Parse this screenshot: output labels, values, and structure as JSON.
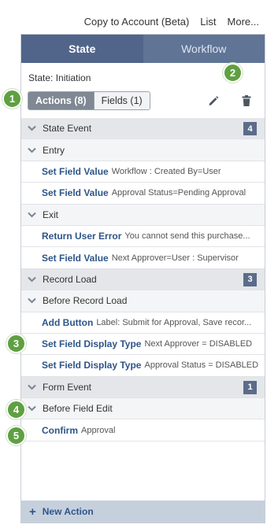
{
  "top_links": [
    "Copy to Account (Beta)",
    "List",
    "More..."
  ],
  "tabs": [
    {
      "label": "State",
      "active": true
    },
    {
      "label": "Workflow",
      "active": false
    }
  ],
  "state_title": "State: Initiation",
  "segments": {
    "actions": "Actions (8)",
    "fields": "Fields (1)"
  },
  "toolbar": {
    "edit_icon": "pencil-icon",
    "delete_icon": "trash-icon"
  },
  "rows": [
    {
      "type": "group",
      "label": "State Event",
      "badge": "4"
    },
    {
      "type": "sub",
      "label": "Entry"
    },
    {
      "type": "action",
      "name": "Set Field Value",
      "desc": "Workflow : Created By=User"
    },
    {
      "type": "action",
      "name": "Set Field Value",
      "desc": "Approval Status=Pending Approval"
    },
    {
      "type": "sub",
      "label": "Exit"
    },
    {
      "type": "action",
      "name": "Return User Error",
      "desc": "You cannot send this purchase..."
    },
    {
      "type": "action",
      "name": "Set Field Value",
      "desc": "Next Approver=User : Supervisor"
    },
    {
      "type": "group",
      "label": "Record Load",
      "badge": "3"
    },
    {
      "type": "sub",
      "label": "Before Record Load"
    },
    {
      "type": "action",
      "name": "Add Button",
      "desc": "Label: Submit for Approval, Save recor..."
    },
    {
      "type": "action",
      "name": "Set Field Display Type",
      "desc": "Next Approver = DISABLED"
    },
    {
      "type": "action",
      "name": "Set Field Display Type",
      "desc": "Approval Status = DISABLED"
    },
    {
      "type": "group",
      "label": "Form Event",
      "badge": "1"
    },
    {
      "type": "sub",
      "label": "Before Field Edit"
    },
    {
      "type": "action",
      "name": "Confirm",
      "desc": "Approval"
    }
  ],
  "footer": {
    "label": "New Action"
  },
  "callouts": [
    "1",
    "2",
    "3",
    "4",
    "5"
  ],
  "colors": {
    "tab_bar": "#607496",
    "link_blue": "#2e5588",
    "callout_green": "#5fa042",
    "badge": "#5b6c8a",
    "footer": "#c6d0dd"
  }
}
